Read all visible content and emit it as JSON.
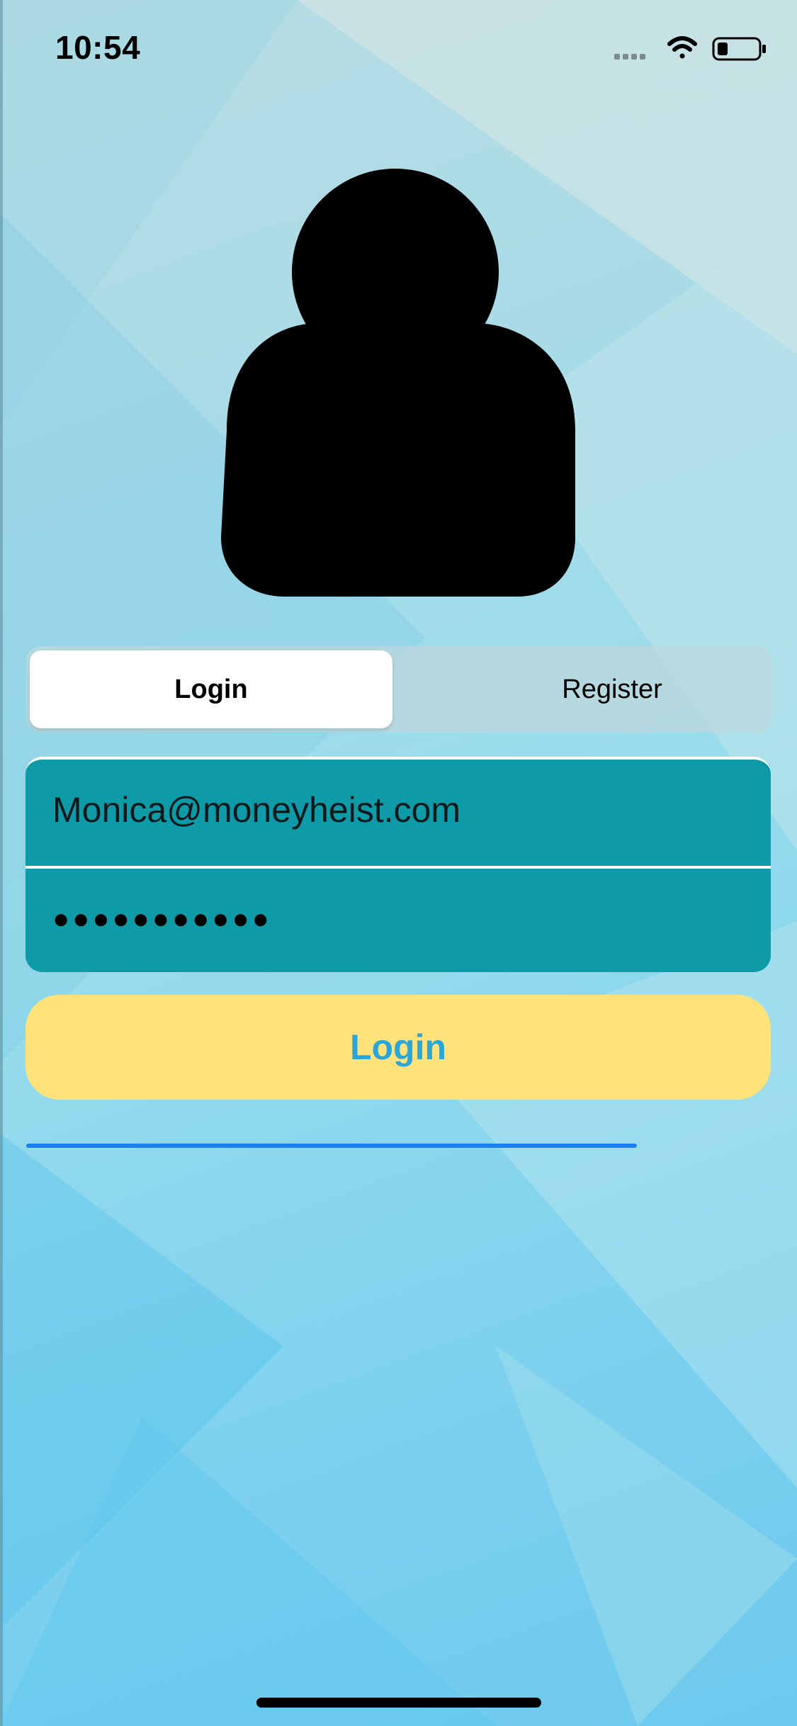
{
  "status_bar": {
    "time": "10:54",
    "icons": [
      "signal-icon",
      "wifi-icon",
      "battery-icon"
    ]
  },
  "avatar": {
    "icon": "user-silhouette-icon"
  },
  "segmented_control": {
    "options": [
      {
        "label": "Login",
        "selected": true
      },
      {
        "label": "Register",
        "selected": false
      }
    ]
  },
  "form": {
    "email_value": "Monica@moneyheist.com",
    "password_masked": "●●●●●●●●●●●"
  },
  "login_button": {
    "label": "Login"
  },
  "colors": {
    "field_background": "#0f9aa8",
    "button_background": "#ffe27a",
    "button_text": "#2aa6d8",
    "progress_line": "#1a7ff0"
  }
}
